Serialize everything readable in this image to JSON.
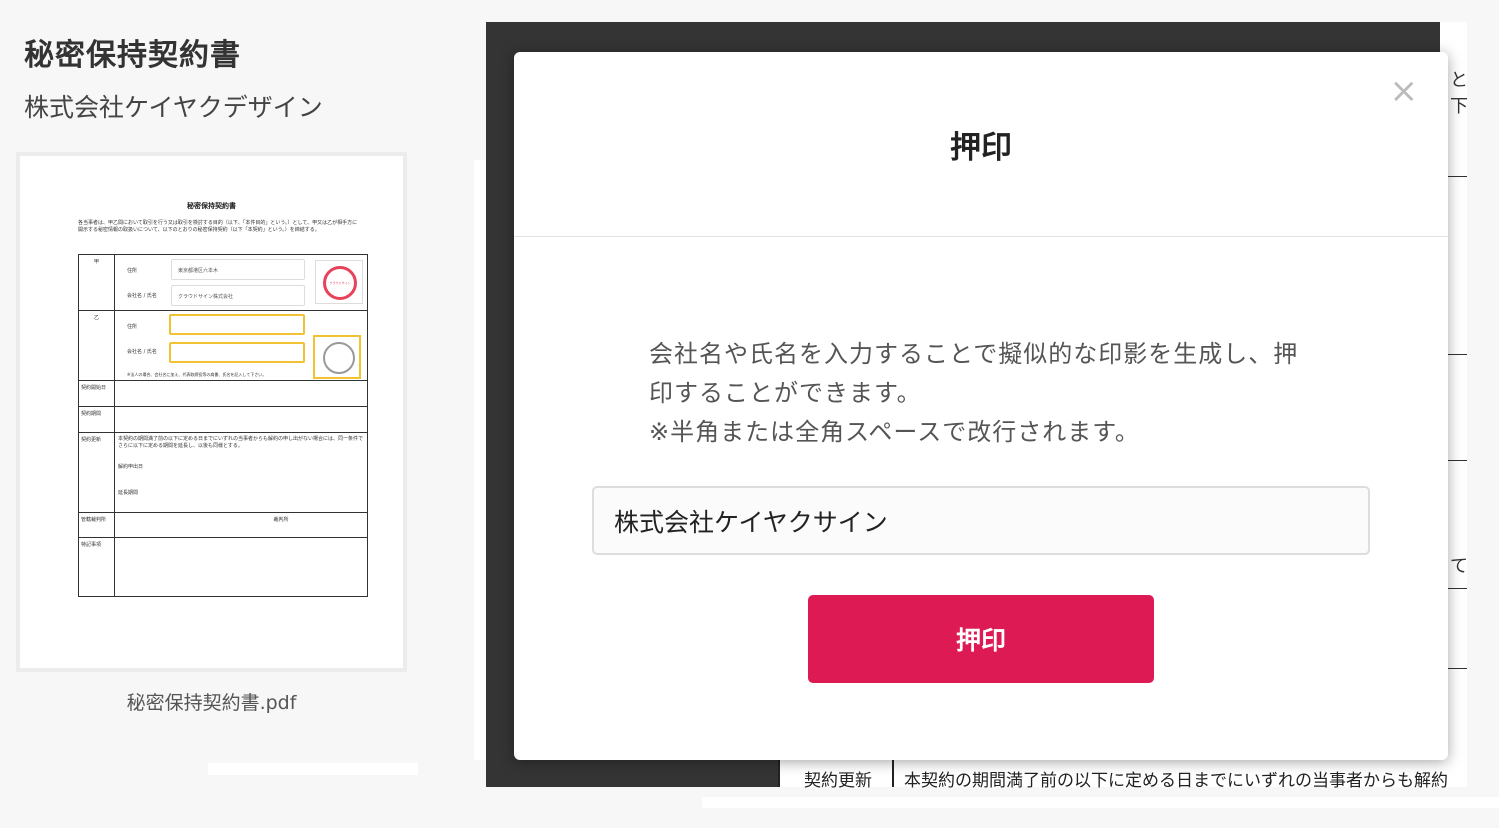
{
  "document": {
    "title": "秘密保持契約書",
    "company": "株式会社ケイヤクデザイン",
    "filename": "秘密保持契約書.pdf"
  },
  "thumbnail": {
    "title": "秘密保持契約書",
    "intro": "各当事者は、甲乙間において取引を行う又は取引を検討する目的（以下、「本件目的」という。）として、甲又は乙が相手方に開示する秘密情報の取扱いについて、以下のとおりの秘密保持契約（以下「本契約」という。）を締結する。",
    "party_a": "甲",
    "party_b": "乙",
    "address_label": "住所",
    "name_label": "会社名 / 氏名",
    "a_address": "東京都港区六本木",
    "a_name": "クラウドサイン株式会社",
    "stamp_text": "クラウドサイン",
    "b_note": "※法人の場合、会社名に加え、代表取締役等の肩書、氏名を記入して下さい。",
    "start_label": "契約開始日",
    "term_label": "契約期間",
    "renew_label": "契約更新",
    "renew_text": "本契約の期間満了前の以下に定める日までにいずれの当事者からも解約の申し出がない場合には、同一条件でさらに以下に定める期間を延長し、以後も同様とする。",
    "cancel_label": "解約申出日",
    "extend_label": "延長期間",
    "court_label": "管轄裁判所",
    "court_suffix": "裁判所",
    "special_label": "特記事項"
  },
  "background": {
    "row_label": "契約更新",
    "row_text": "本契約の期間満了前の以下に定める日までにいずれの当事者からも解約",
    "peek_1": "と",
    "peek_2": "下",
    "peek_3": "て"
  },
  "modal": {
    "close": "×",
    "title": "押印",
    "desc_line1": "会社名や氏名を入力することで擬似的な印影を生成し、押",
    "desc_line2": "印することができます。",
    "desc_line3": "※半角または全角スペースで改行されます。",
    "input_value": "株式会社ケイヤクサイン",
    "submit_label": "押印"
  },
  "colors": {
    "accent": "#de1a55",
    "highlight": "#f1c232",
    "stamp": "#e8425b"
  }
}
